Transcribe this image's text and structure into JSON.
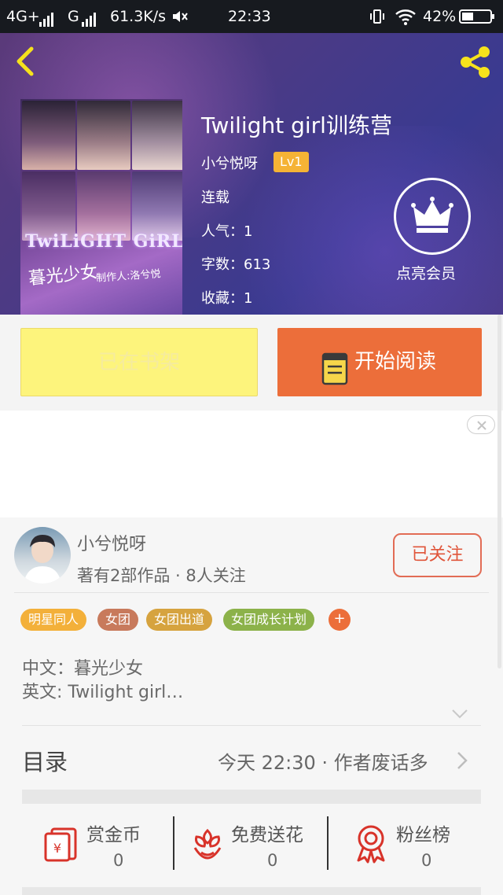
{
  "status_bar": {
    "network1": "4G+",
    "network2": "G",
    "speed": "61.3K/s",
    "time": "22:33",
    "battery": "42%"
  },
  "book": {
    "title": "Twilight girl训练营",
    "author": "小兮悦呀",
    "level": "Lv1",
    "status": "连载",
    "popularity": "人气：1",
    "word_count": "字数：613",
    "favorites": "收藏：1",
    "cover_title": "TwiLiGHT GiRL",
    "cover_subtitle": "暮光少女",
    "cover_credit": "制作人:洛兮悦"
  },
  "vip": {
    "label": "点亮会员"
  },
  "actions": {
    "shelf_label": "已在书架",
    "read_label": "开始阅读"
  },
  "author_section": {
    "name": "小兮悦呀",
    "stats": "著有2部作品 · 8人关注",
    "follow_label": "已关注"
  },
  "tags": [
    {
      "label": "明星同人",
      "color": "#f3b03a"
    },
    {
      "label": "女团",
      "color": "#c87a5c"
    },
    {
      "label": "女团出道",
      "color": "#d6a33f"
    },
    {
      "label": "女团成长计划",
      "color": "#8cb24a"
    }
  ],
  "tag_more": "+",
  "description": {
    "line1": "中文：暮光少女",
    "line2": "英文: Twilight girl…"
  },
  "toc": {
    "title": "目录",
    "latest": "今天 22:30 · 作者废话多"
  },
  "stats": [
    {
      "label": "赏金币",
      "value": "0",
      "icon": "red-envelope-icon"
    },
    {
      "label": "免费送花",
      "value": "0",
      "icon": "flower-icon"
    },
    {
      "label": "粉丝榜",
      "value": "0",
      "icon": "ribbon-medal-icon"
    }
  ],
  "colors": {
    "accent_orange": "#ec6e3a",
    "shelf_yellow": "#fdf47c",
    "level_badge": "#f5b335",
    "icon_red": "#d8332a"
  }
}
